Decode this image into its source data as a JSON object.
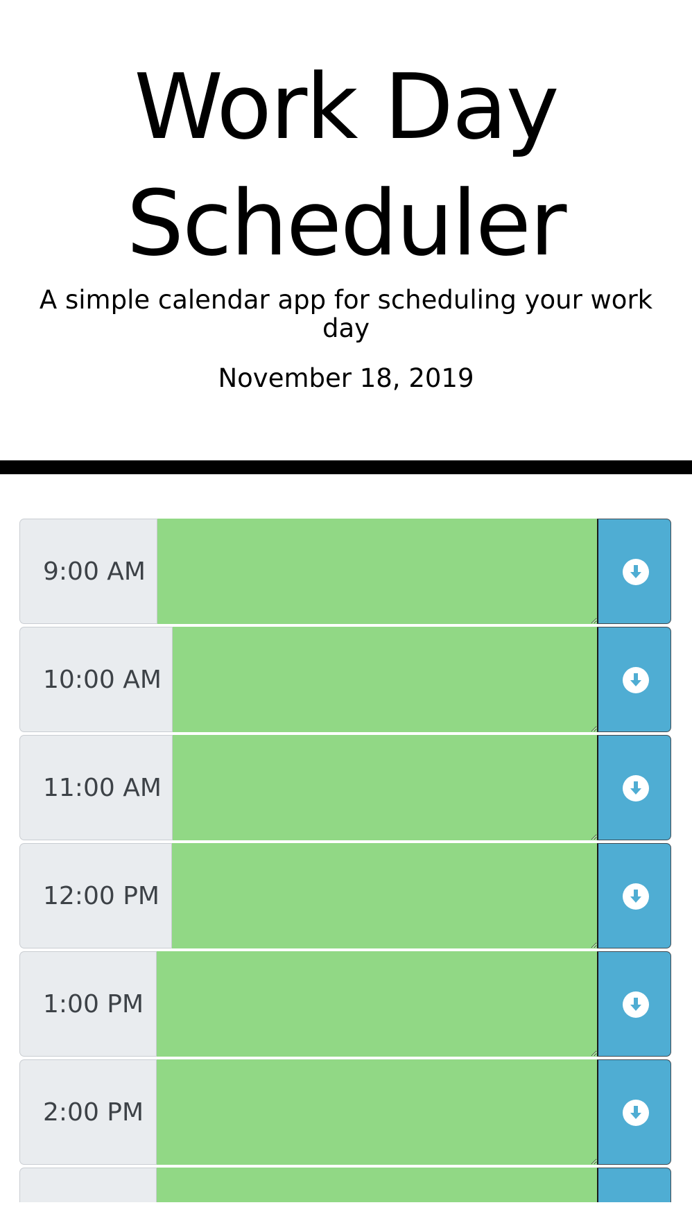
{
  "header": {
    "title": "Work Day Scheduler",
    "subtitle": "A simple calendar app for scheduling your work day",
    "current_date": "November 18, 2019"
  },
  "colors": {
    "hour_background": "#e9ecef",
    "future_block": "#91d885",
    "save_button": "#4fadd3",
    "divider": "#000000"
  },
  "save_icon": "download-circle-icon",
  "time_blocks": [
    {
      "hour": "9:00 AM",
      "entry_text": ""
    },
    {
      "hour": "10:00 AM",
      "entry_text": ""
    },
    {
      "hour": "11:00 AM",
      "entry_text": ""
    },
    {
      "hour": "12:00 PM",
      "entry_text": ""
    },
    {
      "hour": "1:00 PM",
      "entry_text": ""
    },
    {
      "hour": "2:00 PM",
      "entry_text": ""
    },
    {
      "hour": "",
      "entry_text": ""
    }
  ]
}
